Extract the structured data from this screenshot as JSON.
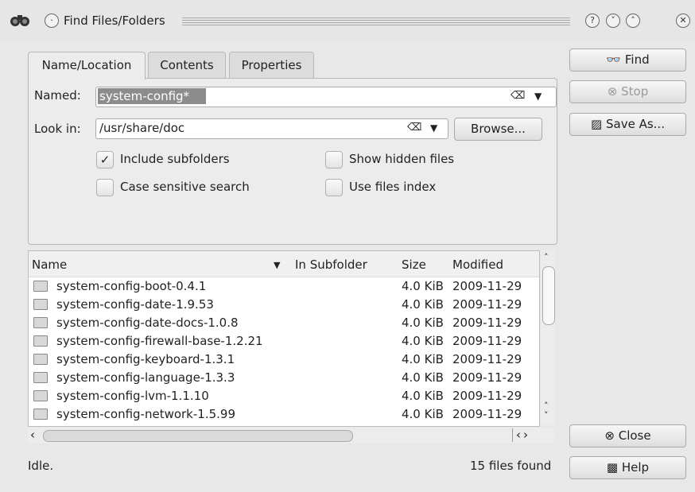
{
  "window": {
    "title": "Find Files/Folders",
    "controls": {
      "help": "?",
      "minimize": "˅",
      "maximize": "˄",
      "close": "✕"
    }
  },
  "tabs": [
    {
      "label": "Name/Location",
      "active": true
    },
    {
      "label": "Contents",
      "active": false
    },
    {
      "label": "Properties",
      "active": false
    }
  ],
  "form": {
    "named_label": "Named:",
    "named_value": "system-config*",
    "lookin_label": "Look in:",
    "lookin_value": "/usr/share/doc",
    "browse_label": "Browse...",
    "options": {
      "include_subfolders": {
        "label": "Include subfolders",
        "checked": true
      },
      "case_sensitive": {
        "label": "Case sensitive search",
        "checked": false
      },
      "show_hidden": {
        "label": "Show hidden files",
        "checked": false
      },
      "use_index": {
        "label": "Use files index",
        "checked": false
      }
    }
  },
  "side_buttons": {
    "find": "Find",
    "stop": "Stop",
    "save_as": "Save As...",
    "close": "Close",
    "help": "Help"
  },
  "results": {
    "columns": [
      "Name",
      "In Subfolder",
      "Size",
      "Modified"
    ],
    "rows": [
      {
        "name": "system-config-boot-0.4.1",
        "size": "4.0 KiB",
        "modified": "2009-11-29"
      },
      {
        "name": "system-config-date-1.9.53",
        "size": "4.0 KiB",
        "modified": "2009-11-29"
      },
      {
        "name": "system-config-date-docs-1.0.8",
        "size": "4.0 KiB",
        "modified": "2009-11-29"
      },
      {
        "name": "system-config-firewall-base-1.2.21",
        "size": "4.0 KiB",
        "modified": "2009-11-29"
      },
      {
        "name": "system-config-keyboard-1.3.1",
        "size": "4.0 KiB",
        "modified": "2009-11-29"
      },
      {
        "name": "system-config-language-1.3.3",
        "size": "4.0 KiB",
        "modified": "2009-11-29"
      },
      {
        "name": "system-config-lvm-1.1.10",
        "size": "4.0 KiB",
        "modified": "2009-11-29"
      },
      {
        "name": "system-config-network-1.5.99",
        "size": "4.0 KiB",
        "modified": "2009-11-29"
      }
    ]
  },
  "status": {
    "left": "Idle.",
    "right": "15 files found"
  }
}
